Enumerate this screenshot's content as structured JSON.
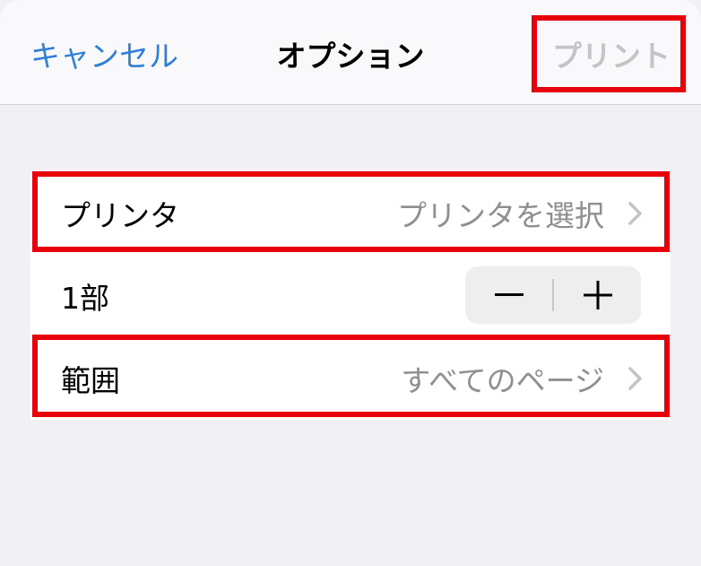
{
  "navbar": {
    "cancel_label": "キャンセル",
    "title": "オプション",
    "print_label": "プリント"
  },
  "options": {
    "printer": {
      "label": "プリンタ",
      "value": "プリンタを選択"
    },
    "copies": {
      "label": "1部",
      "minus_icon": "minus-icon",
      "plus_icon": "plus-icon"
    },
    "range": {
      "label": "範囲",
      "value": "すべてのページ"
    }
  },
  "colors": {
    "accent": "#2f7fd8",
    "disabled": "#c4c4c7",
    "secondary_text": "#8e8e93",
    "background": "#f1f0f5",
    "highlight": "#e8000b"
  }
}
